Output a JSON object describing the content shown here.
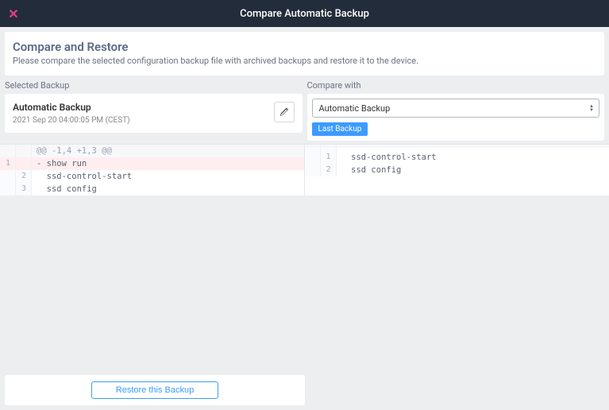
{
  "titlebar": {
    "title": "Compare Automatic Backup"
  },
  "header": {
    "title": "Compare and Restore",
    "subtitle": "Please compare the selected configuration backup file with archived backups and restore it to the device."
  },
  "selected": {
    "label": "Selected Backup",
    "name": "Automatic Backup",
    "timestamp": "2021 Sep 20 04:00:05 PM (CEST)"
  },
  "compare": {
    "label": "Compare with",
    "select_value": "Automatic Backup",
    "chip_label": "Last Backup"
  },
  "diff": {
    "left": [
      {
        "kind": "hunk",
        "a": "",
        "b": "",
        "text": "@@ -1,4 +1,3 @@"
      },
      {
        "kind": "del",
        "a": "1",
        "b": "",
        "text": "- show run"
      },
      {
        "kind": "ctx",
        "a": "",
        "b": "2",
        "text": "  ssd-control-start"
      },
      {
        "kind": "ctx",
        "a": "",
        "b": "3",
        "text": "  ssd config"
      }
    ],
    "right": [
      {
        "kind": "hunk",
        "l": "",
        "r": "",
        "text": ""
      },
      {
        "kind": "blank",
        "l": "",
        "r": "",
        "text": ""
      },
      {
        "kind": "ctx",
        "l": "",
        "r": "1",
        "text": "  ssd-control-start"
      },
      {
        "kind": "ctx",
        "l": "",
        "r": "2",
        "text": "  ssd config"
      }
    ]
  },
  "footer": {
    "restore_label": "Restore this Backup"
  }
}
